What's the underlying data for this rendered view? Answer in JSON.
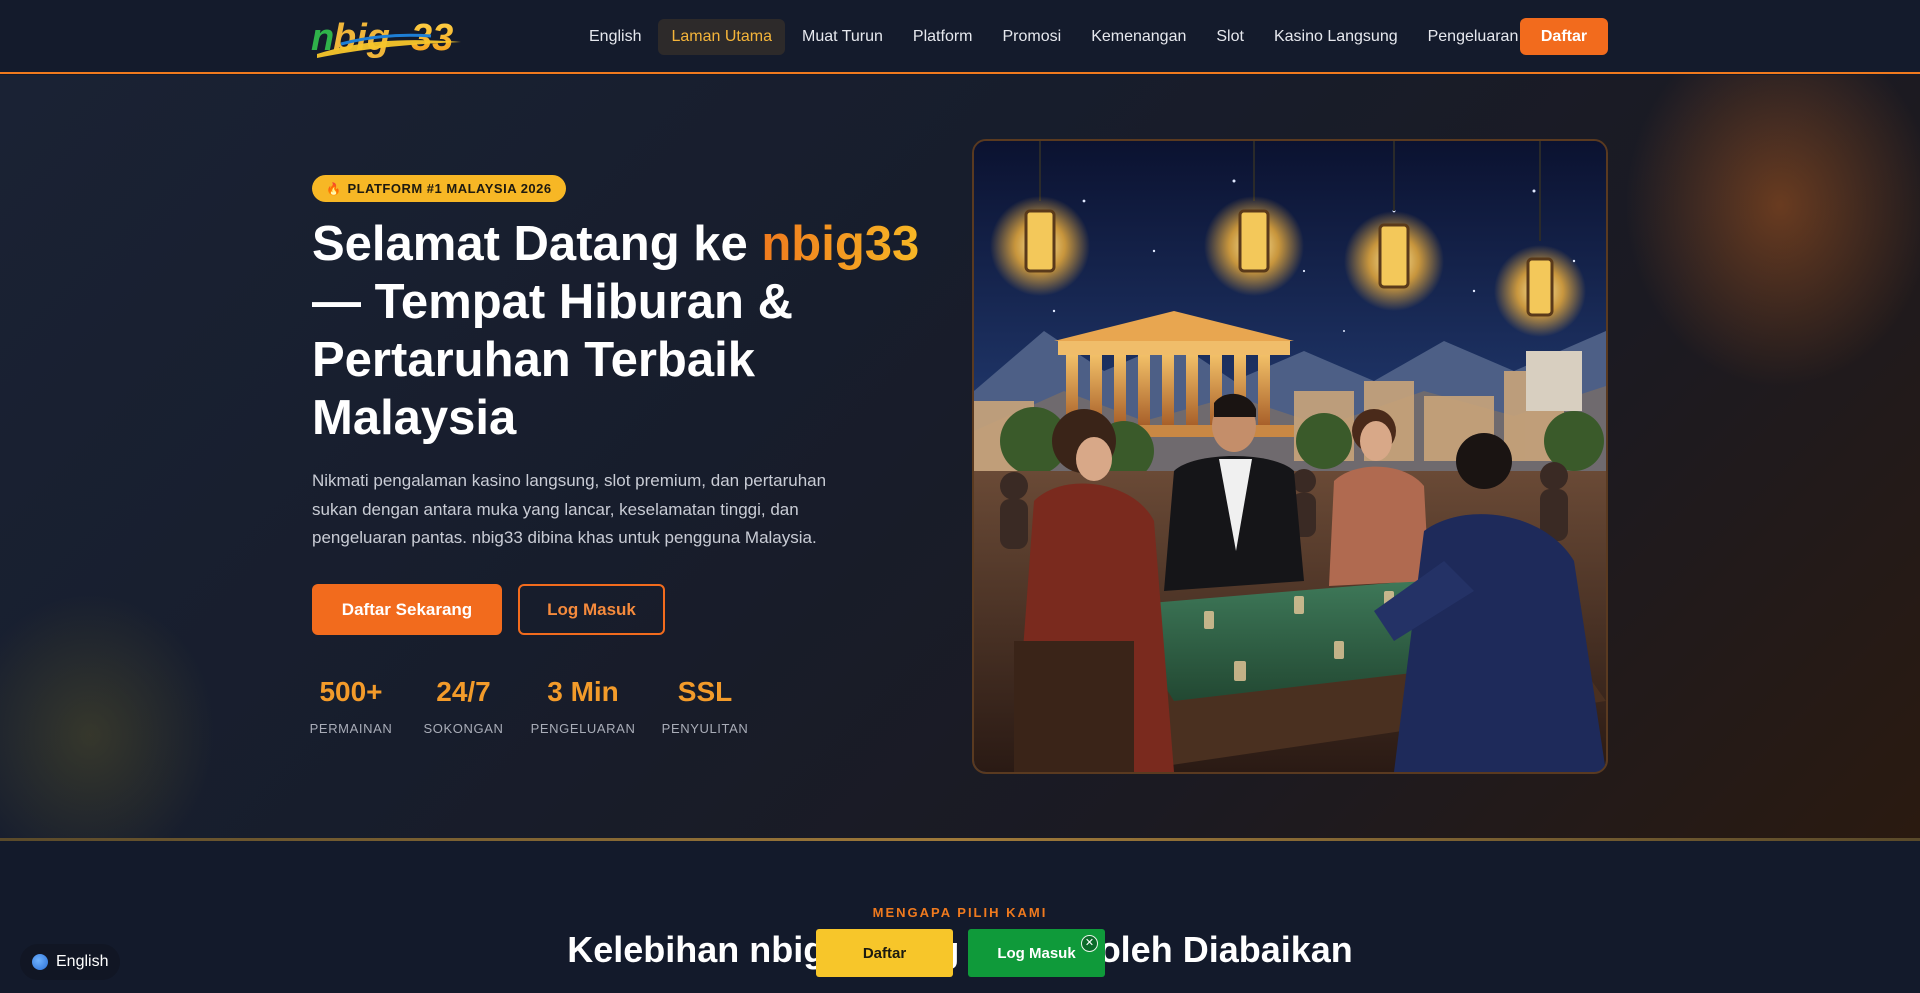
{
  "brand": {
    "logo_text": "nbig33",
    "logo_icon": "nbig33-logo"
  },
  "nav": {
    "items": [
      {
        "label": "English"
      },
      {
        "label": "Laman Utama",
        "active": true
      },
      {
        "label": "Muat Turun"
      },
      {
        "label": "Platform"
      },
      {
        "label": "Promosi"
      },
      {
        "label": "Kemenangan"
      },
      {
        "label": "Slot"
      },
      {
        "label": "Kasino Langsung"
      },
      {
        "label": "Pengeluaran"
      }
    ],
    "cta_label": "Daftar"
  },
  "hero": {
    "badge": "PLATFORM #1 MALAYSIA 2026",
    "badge_icon": "fire-icon",
    "title_before": "Selamat Datang ke ",
    "title_brand": "nbig33",
    "title_after": " — Tempat Hiburan & Pertaruhan Terbaik Malaysia",
    "description": "Nikmati pengalaman kasino langsung, slot premium, dan pertaruhan sukan dengan antara muka yang lancar, keselamatan tinggi, dan pengeluaran pantas. nbig33 dibina khas untuk pengguna Malaysia.",
    "primary_button": "Daftar Sekarang",
    "secondary_button": "Log Masuk",
    "stats": [
      {
        "value": "500+",
        "label": "PERMAINAN"
      },
      {
        "value": "24/7",
        "label": "SOKONGAN"
      },
      {
        "value": "3 Min",
        "label": "PENGELUARAN"
      },
      {
        "value": "SSL",
        "label": "PENYULITAN"
      }
    ],
    "image_subject": "casino-table-illustration"
  },
  "section": {
    "eyebrow": "MENGAPA PILIH KAMI",
    "title": "Kelebihan nbig33 yang Tidak Boleh Diabaikan"
  },
  "floating": {
    "language_label": "English",
    "language_icon": "globe-icon",
    "register_label": "Daftar",
    "login_label": "Log Masuk",
    "close_glyph": "✕"
  },
  "colors": {
    "accent": "#f26b1d",
    "gold": "#f7b725",
    "background": "#131a2b",
    "login_green": "#0f9a3a",
    "register_yellow": "#f7c62a"
  }
}
